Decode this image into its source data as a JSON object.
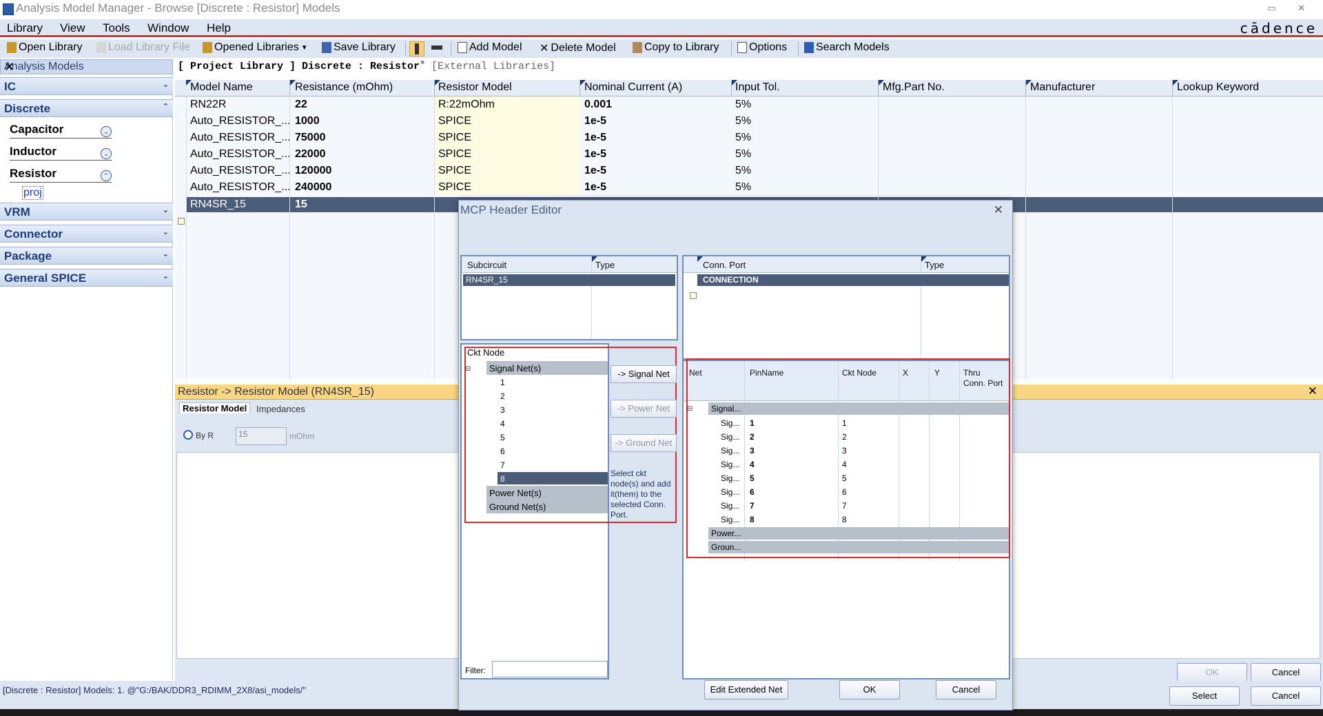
{
  "window": {
    "title": "Analysis Model Manager - Browse [Discrete : Resistor] Models",
    "brand": "cādence"
  },
  "menu": [
    "Library",
    "View",
    "Tools",
    "Window",
    "Help"
  ],
  "toolbar": {
    "open_library": "Open Library",
    "load_library_file": "Load Library File",
    "opened_libraries": "Opened Libraries",
    "save_library": "Save Library",
    "add_model": "Add Model",
    "delete_model": "Delete Model",
    "copy_to_library": "Copy to Library",
    "options": "Options",
    "search_models": "Search Models"
  },
  "left_panel": {
    "title": "Analysis Models",
    "categories": [
      "IC",
      "Discrete",
      "VRM",
      "Connector",
      "Package",
      "General SPICE"
    ],
    "discrete_items": [
      "Capacitor",
      "Inductor",
      "Resistor"
    ],
    "resistor_child": "proj"
  },
  "path_bar": {
    "project": "[ Project Library ] Discrete : Resistor",
    "external": "[External Libraries]"
  },
  "grid": {
    "columns": [
      "Model Name",
      "Resistance (mOhm)",
      "Resistor Model",
      "Nominal Current (A)",
      "Input Tol.",
      "Mfg.Part No.",
      "Manufacturer",
      "Lookup Keyword"
    ],
    "rows": [
      [
        "RN22R",
        "22",
        "R:22mOhm",
        "0.001",
        "5%"
      ],
      [
        "Auto_RESISTOR_...",
        "1000",
        "SPICE",
        "1e-5",
        "5%"
      ],
      [
        "Auto_RESISTOR_...",
        "75000",
        "SPICE",
        "1e-5",
        "5%"
      ],
      [
        "Auto_RESISTOR_...",
        "22000",
        "SPICE",
        "1e-5",
        "5%"
      ],
      [
        "Auto_RESISTOR_...",
        "120000",
        "SPICE",
        "1e-5",
        "5%"
      ],
      [
        "Auto_RESISTOR_...",
        "240000",
        "SPICE",
        "1e-5",
        "5%"
      ],
      [
        "RN4SR_15",
        "15",
        "",
        "",
        ""
      ]
    ]
  },
  "lower": {
    "header": "Resistor -> Resistor Model (RN4SR_15)",
    "tabs": [
      "Resistor Model",
      "Impedances"
    ],
    "by_r": "By R",
    "value": "15",
    "unit": "mOhm",
    "ok": "OK",
    "cancel": "Cancel"
  },
  "status": {
    "text": "[Discrete : Resistor] Models: 1. @\"G:/BAK/DDR3_RDIMM_2X8/asi_models/\"",
    "select": "Select",
    "cancel": "Cancel"
  },
  "dialog": {
    "title": "MCP Header Editor",
    "subckt_cols": [
      "Subcircuit",
      "Type"
    ],
    "subckt_row": "RN4SR_15",
    "conn_cols": [
      "Conn. Port",
      "Type"
    ],
    "conn_row": "CONNECTION",
    "ckt_node_header": "Ckt Node",
    "signal_group": "Signal Net(s)",
    "nodes": [
      "1",
      "2",
      "3",
      "4",
      "5",
      "6",
      "7",
      "8"
    ],
    "power_group": "Power Net(s)",
    "ground_group": "Ground Net(s)",
    "btn_signal": "-> Signal Net",
    "btn_power": "-> Power Net",
    "btn_ground": "-> Ground Net",
    "help_text": "Select ckt node(s) and add it(them) to the selected Conn. Port.",
    "net_cols": [
      "Net",
      "PinName",
      "Ckt Node",
      "X",
      "Y",
      "Thru Conn. Port"
    ],
    "net_group": "Signal...",
    "net_rows": [
      {
        "net": "Sig...",
        "pin": "1",
        "node": "1"
      },
      {
        "net": "Sig...",
        "pin": "2",
        "node": "2"
      },
      {
        "net": "Sig...",
        "pin": "3",
        "node": "3"
      },
      {
        "net": "Sig...",
        "pin": "4",
        "node": "4"
      },
      {
        "net": "Sig...",
        "pin": "5",
        "node": "5"
      },
      {
        "net": "Sig...",
        "pin": "6",
        "node": "6"
      },
      {
        "net": "Sig...",
        "pin": "7",
        "node": "7"
      },
      {
        "net": "Sig...",
        "pin": "8",
        "node": "8"
      }
    ],
    "power_row": "Power...",
    "ground_row": "Groun...",
    "filter_label": "Filter:",
    "edit_extended_net": "Edit Extended Net",
    "ok": "OK",
    "cancel": "Cancel"
  }
}
